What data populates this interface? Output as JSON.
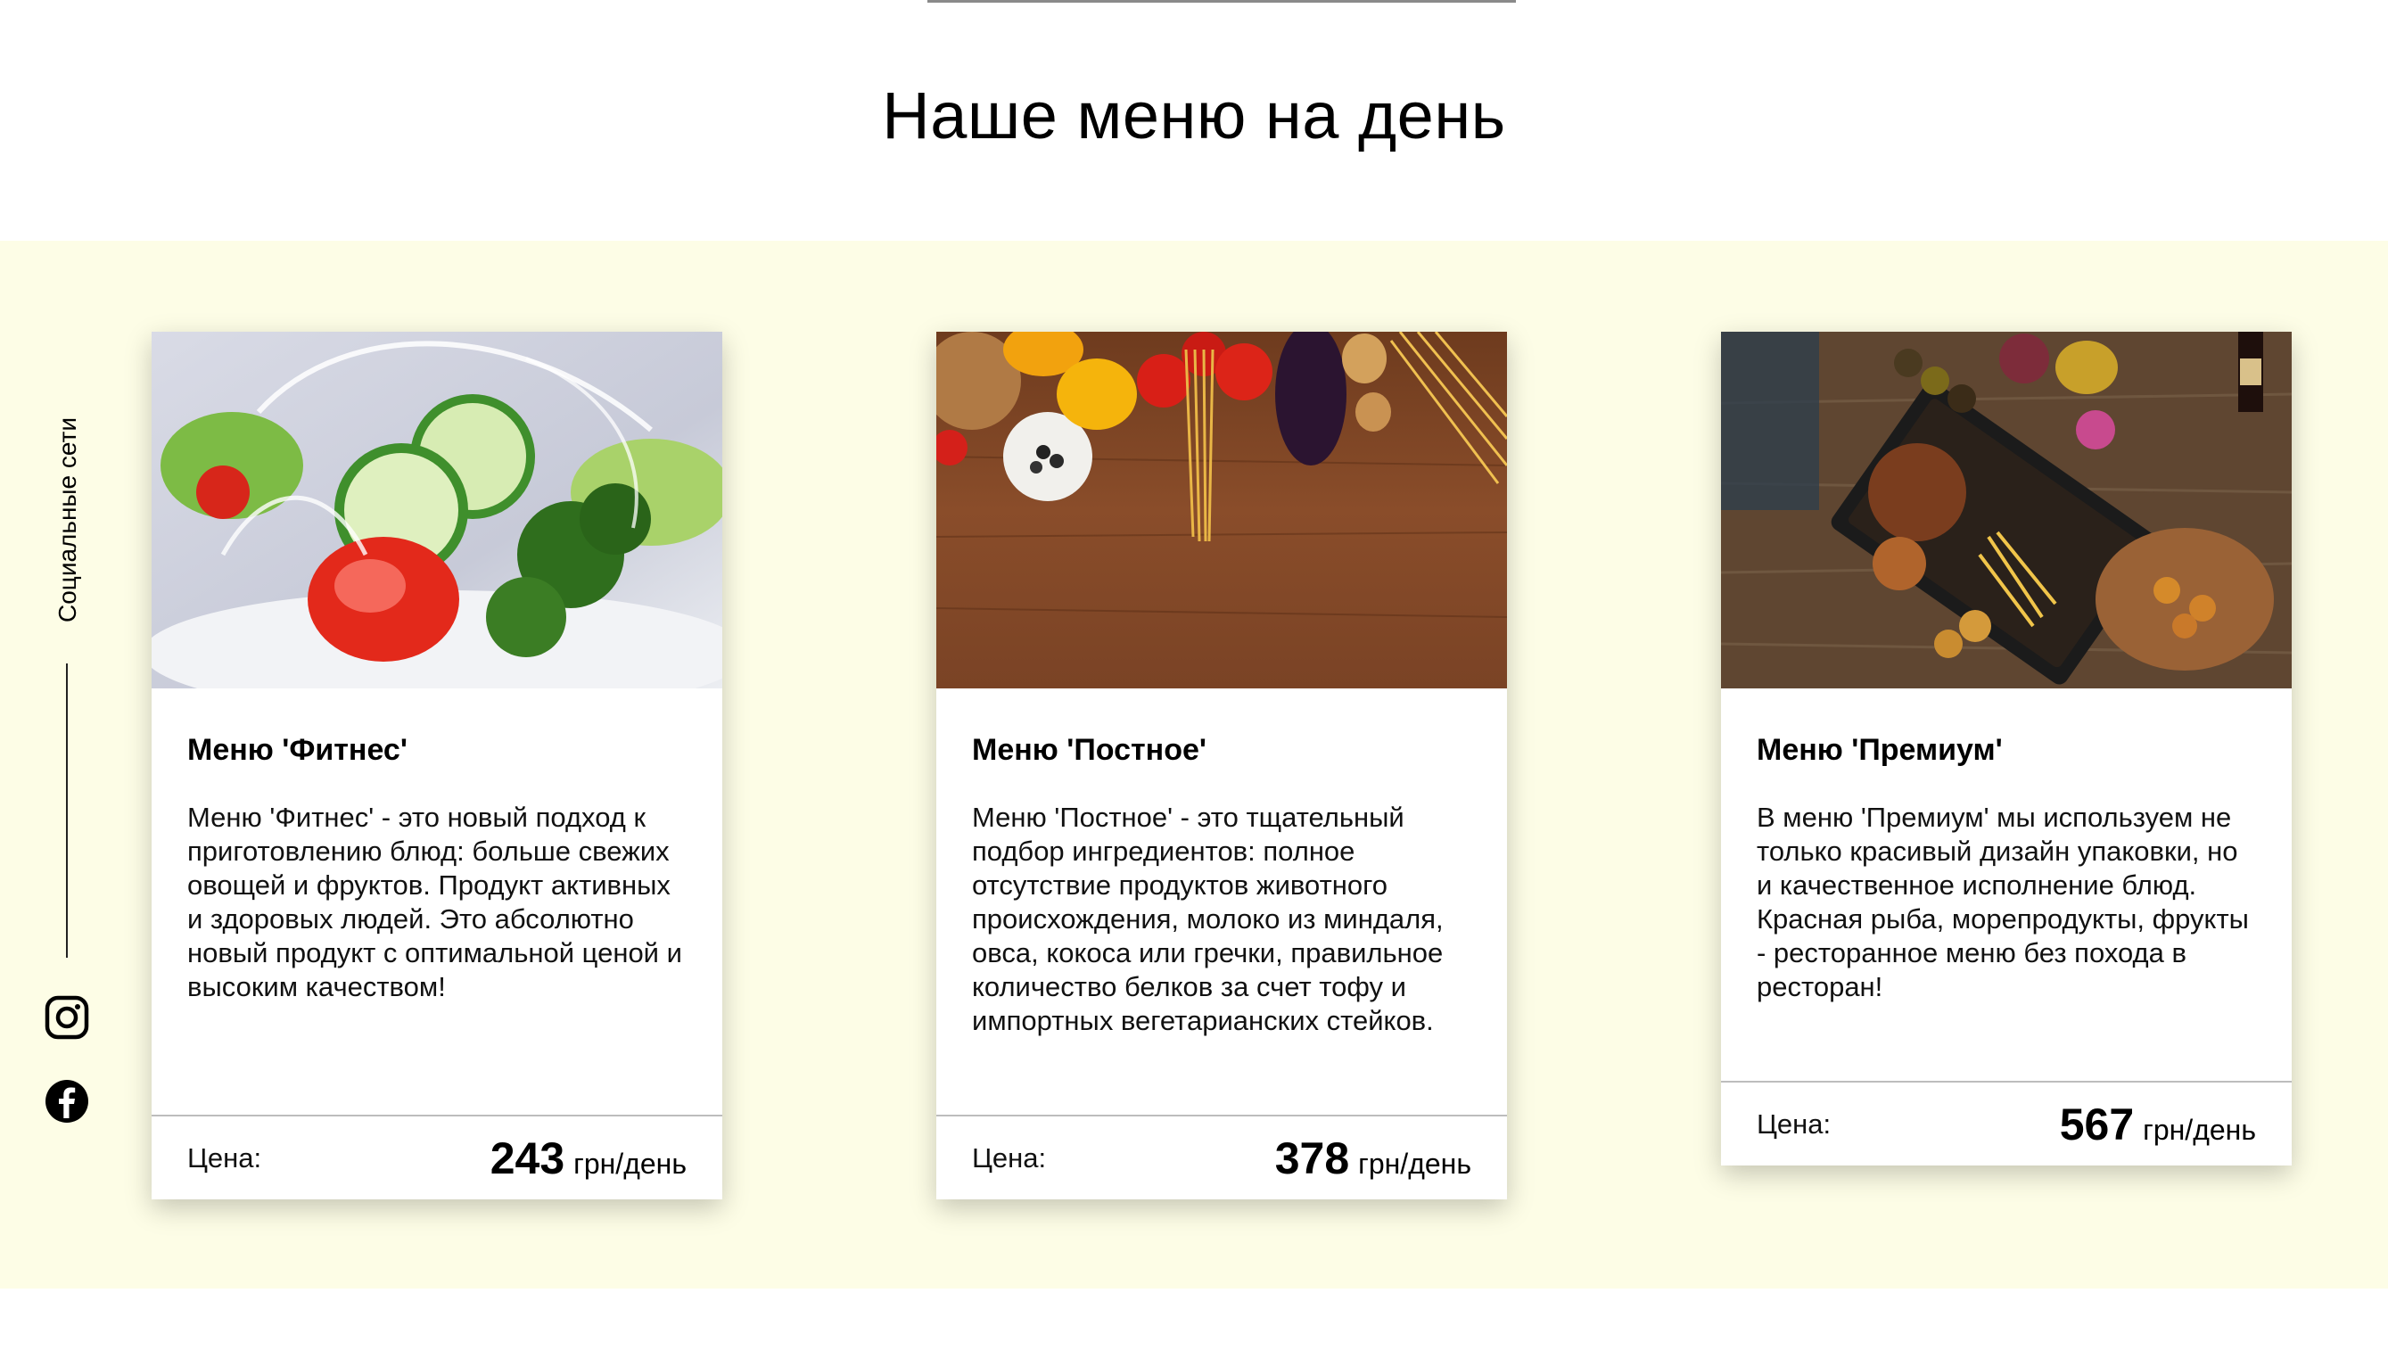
{
  "page": {
    "title": "Наше меню на день"
  },
  "social": {
    "label": "Социальные сети",
    "icons": [
      "instagram-icon",
      "facebook-icon"
    ]
  },
  "colors": {
    "section_bg": "#fdfde6",
    "card_bg": "#ffffff",
    "divider": "#bdbdbd"
  },
  "cards": [
    {
      "image": "fitness-salad-photo",
      "title": "Меню 'Фитнес'",
      "description": "Меню 'Фитнес' - это новый подход к приготовлению блюд: больше свежих овощей и фруктов. Продукт активных и здоровых людей. Это абсолютно новый продукт с оптимальной ценой и высоким качеством!",
      "price_label": "Цена:",
      "price": "243",
      "price_unit": "грн/день"
    },
    {
      "image": "lenten-vegetables-photo",
      "title": "Меню 'Постное'",
      "description": "Меню 'Постное' - это тщательный подбор ингредиентов: полное отсутствие продуктов животного происхождения, молоко из миндаля, овса, кокоса или гречки, правильное количество белков за счет тофу и импортных вегетарианских стейков.",
      "price_label": "Цена:",
      "price": "378",
      "price_unit": "грн/день"
    },
    {
      "image": "premium-platter-photo",
      "title": "Меню 'Премиум'",
      "description": "В меню 'Премиум' мы используем не только красивый дизайн упаковки, но и качественное исполнение блюд. Красная рыба, морепродукты, фрукты - ресторанное меню без похода в ресторан!",
      "price_label": "Цена:",
      "price": "567",
      "price_unit": "грн/день"
    }
  ]
}
